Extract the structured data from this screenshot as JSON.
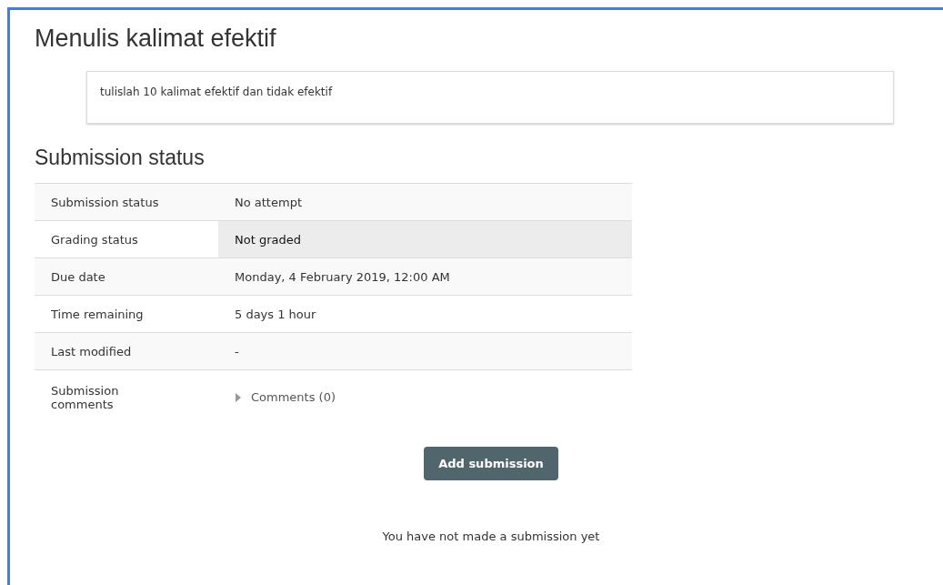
{
  "title": "Menulis kalimat efektif",
  "description": "tulislah 10 kalimat efektif dan tidak efektif",
  "section_heading": "Submission status",
  "rows": [
    {
      "label": "Submission status",
      "value": "No attempt",
      "highlighted": false
    },
    {
      "label": "Grading status",
      "value": "Not graded",
      "highlighted": true
    },
    {
      "label": "Due date",
      "value": "Monday, 4 February 2019, 12:00 AM",
      "highlighted": false
    },
    {
      "label": "Time remaining",
      "value": "5 days 1 hour",
      "highlighted": false
    },
    {
      "label": "Last modified",
      "value": "-",
      "highlighted": false
    },
    {
      "label": "Submission comments",
      "value": "Comments (0)",
      "kind": "toggle",
      "expanded": false,
      "highlighted": false
    }
  ],
  "button": "Add submission",
  "footer_note": "You have not made a submission yet"
}
